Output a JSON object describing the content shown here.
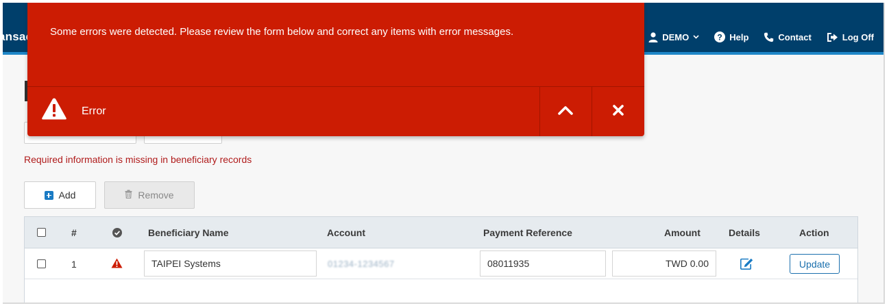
{
  "app": {
    "brand_fragment": "ansac",
    "nav": {
      "user_label": "DEMO",
      "help_label": "Help",
      "contact_label": "Contact",
      "logoff_label": "Log Off"
    }
  },
  "toast": {
    "message": "Some errors were detected. Please review the form below and correct any items with error messages.",
    "title": "Error",
    "icons": {
      "status": "warning-triangle-icon",
      "collapse": "chevron-up-icon",
      "close": "close-x-icon"
    }
  },
  "form": {
    "required_message": "Required information is missing in beneficiary records",
    "add_label": "Add",
    "remove_label": "Remove"
  },
  "table": {
    "headers": {
      "index": "#",
      "beneficiary": "Beneficiary Name",
      "account": "Account",
      "reference": "Payment Reference",
      "amount": "Amount",
      "details": "Details",
      "action": "Action"
    },
    "rows": [
      {
        "index": "1",
        "beneficiary": "TAIPEI Systems",
        "account": "01234-1234567",
        "reference": "08011935",
        "amount": "TWD 0.00",
        "action_label": "Update"
      }
    ]
  },
  "colors": {
    "header_bg": "#003f6b",
    "header_accent": "#1f87c8",
    "error_red": "#cc1c03",
    "error_text": "#b01b1b",
    "primary_blue": "#1a6fad"
  }
}
